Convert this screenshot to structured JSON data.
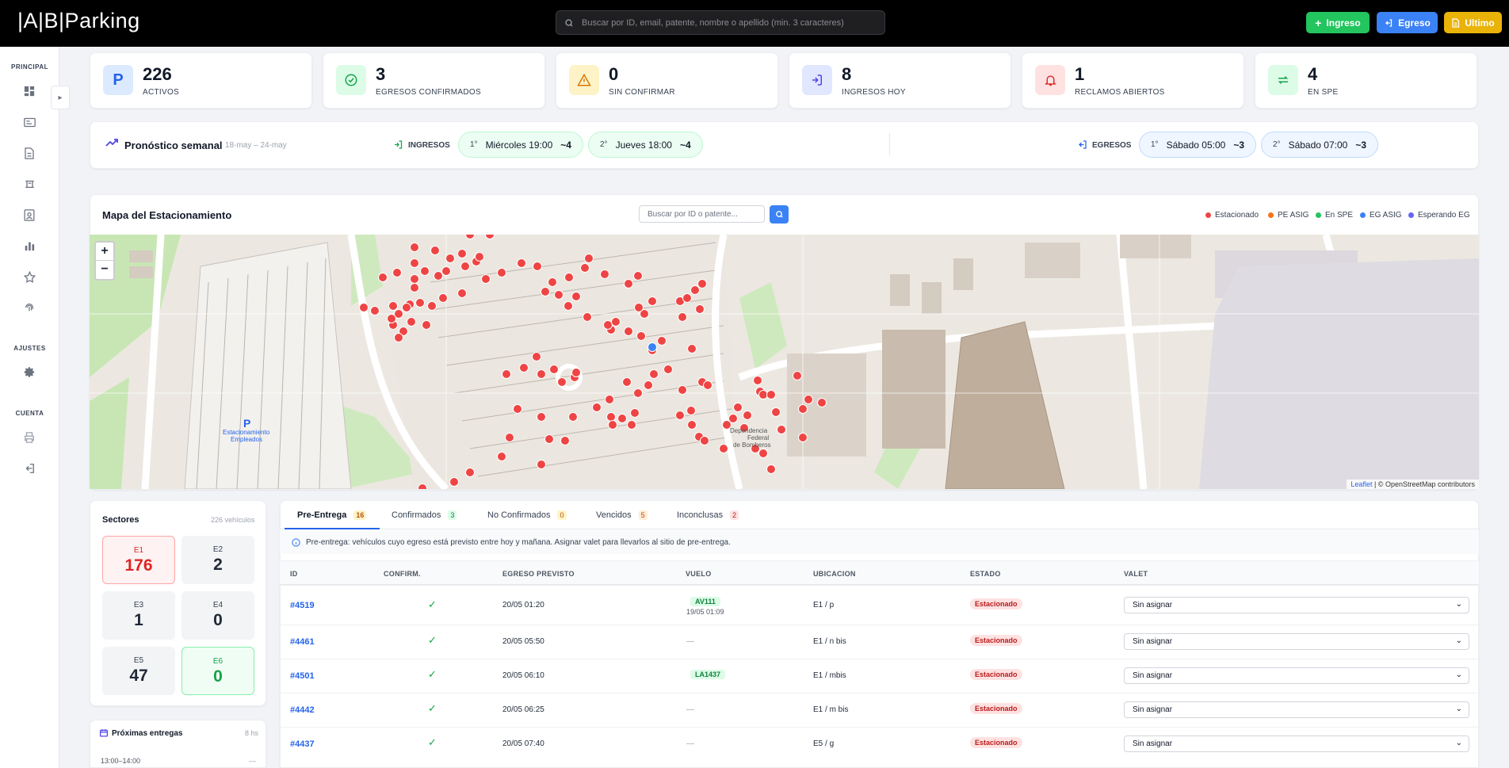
{
  "app": {
    "logo": "|A|B|Parking"
  },
  "search": {
    "placeholder": "Buscar por ID, email, patente, nombre o apellido (min. 3 caracteres)"
  },
  "toolbar": {
    "ingreso": "Ingreso",
    "egreso": "Egreso",
    "ultimo": "Ultimo"
  },
  "sidebar": {
    "principal": "PRINCIPAL",
    "ajustes": "AJUSTES",
    "cuenta": "CUENTA"
  },
  "stats": [
    {
      "value": "226",
      "label": "ACTIVOS",
      "icon": "parking-icon"
    },
    {
      "value": "3",
      "label": "EGRESOS CONFIRMADOS",
      "icon": "check-circle-icon"
    },
    {
      "value": "0",
      "label": "SIN CONFIRMAR",
      "icon": "warning-icon"
    },
    {
      "value": "8",
      "label": "INGRESOS HOY",
      "icon": "login-icon"
    },
    {
      "value": "1",
      "label": "RECLAMOS ABIERTOS",
      "icon": "bell-icon"
    },
    {
      "value": "4",
      "label": "EN SPE",
      "icon": "swap-icon"
    }
  ],
  "forecast": {
    "title": "Pronóstico semanal",
    "range": "18-may – 24-may",
    "ingresos_label": "INGRESOS",
    "egresos_label": "EGRESOS",
    "ingresos": [
      {
        "rank": "1°",
        "when": "Miércoles 19:00",
        "count": "~4"
      },
      {
        "rank": "2°",
        "when": "Jueves 18:00",
        "count": "~4"
      }
    ],
    "egresos": [
      {
        "rank": "1°",
        "when": "Sábado 05:00",
        "count": "~3"
      },
      {
        "rank": "2°",
        "when": "Sábado 07:00",
        "count": "~3"
      }
    ]
  },
  "map": {
    "title": "Mapa del Estacionamiento",
    "search_placeholder": "Buscar por ID o patente...",
    "legend": [
      {
        "label": "Estacionado",
        "color": "#ef4444"
      },
      {
        "label": "PE ASIG",
        "color": "#f97316"
      },
      {
        "label": "En SPE",
        "color": "#22c55e"
      },
      {
        "label": "EG ASIG",
        "color": "#3b82f6"
      },
      {
        "label": "Esperando EG",
        "color": "#6366f1"
      }
    ],
    "zoom_in": "+",
    "zoom_out": "−",
    "poi_1": "Estacionamiento",
    "poi_2": "Empleados",
    "poi_3": "Dependencia",
    "poi_4": "Federal",
    "poi_5": "de Bomberos",
    "attrib_leaflet": "Leaflet",
    "attrib_osm": "| © OpenStreetMap contributors"
  },
  "sectors": {
    "title": "Sectores",
    "count": "226 vehículos",
    "items": [
      {
        "label": "E1",
        "value": "176"
      },
      {
        "label": "E2",
        "value": "2"
      },
      {
        "label": "E3",
        "value": "1"
      },
      {
        "label": "E4",
        "value": "0"
      },
      {
        "label": "E5",
        "value": "47"
      },
      {
        "label": "E6",
        "value": "0"
      }
    ]
  },
  "proximas": {
    "title": "Próximas entregas",
    "hours": "8 hs",
    "slot": "13:00–14:00",
    "slot_value": "—"
  },
  "tabs": [
    {
      "label": "Pre-Entrega",
      "count": "16"
    },
    {
      "label": "Confirmados",
      "count": "3"
    },
    {
      "label": "No Confirmados",
      "count": "0"
    },
    {
      "label": "Vencidos",
      "count": "5"
    },
    {
      "label": "Inconclusas",
      "count": "2"
    }
  ],
  "info": "Pre-entrega: vehículos cuyo egreso está previsto entre hoy y mañana. Asignar valet para llevarlos al sitio de pre-entrega.",
  "table": {
    "headers": [
      "ID",
      "CONFIRM.",
      "EGRESO PREVISTO",
      "VUELO",
      "UBICACION",
      "ESTADO",
      "VALET"
    ],
    "rows": [
      {
        "id": "#4519",
        "egreso": "20/05 01:20",
        "vuelo": "AV111",
        "vuelo_sub": "19/05 01:09",
        "ubic": "E1 / p",
        "estado": "Estacionado",
        "valet": "Sin asignar"
      },
      {
        "id": "#4461",
        "egreso": "20/05 05:50",
        "vuelo": "—",
        "vuelo_sub": "",
        "ubic": "E1 / n bis",
        "estado": "Estacionado",
        "valet": "Sin asignar"
      },
      {
        "id": "#4501",
        "egreso": "20/05 06:10",
        "vuelo": "LA1437",
        "vuelo_sub": "",
        "ubic": "E1 / mbis",
        "estado": "Estacionado",
        "valet": "Sin asignar"
      },
      {
        "id": "#4442",
        "egreso": "20/05 06:25",
        "vuelo": "—",
        "vuelo_sub": "",
        "ubic": "E1 / m bis",
        "estado": "Estacionado",
        "valet": "Sin asignar"
      },
      {
        "id": "#4437",
        "egreso": "20/05 07:40",
        "vuelo": "—",
        "vuelo_sub": "",
        "ubic": "E5 / g",
        "estado": "Estacionado",
        "valet": "Sin asignar"
      }
    ]
  }
}
